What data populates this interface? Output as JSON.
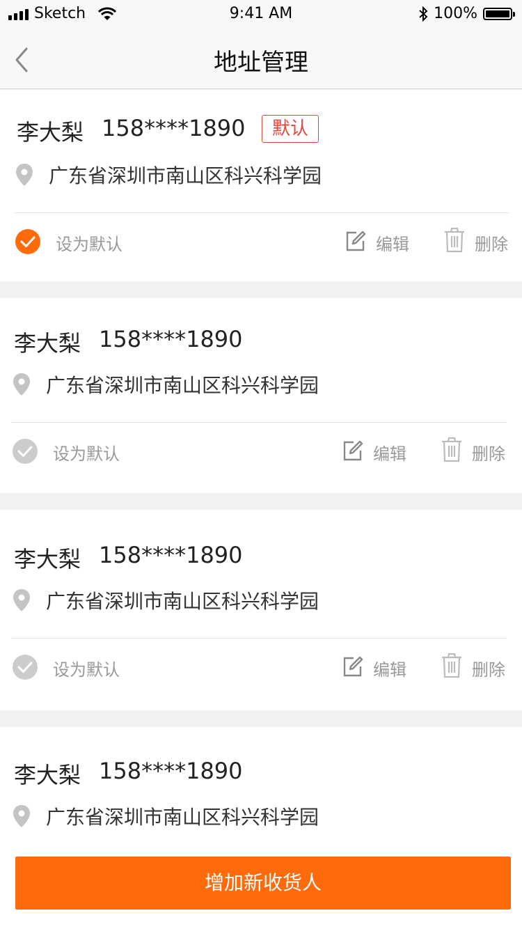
{
  "status_bar": {
    "carrier": "Sketch",
    "time": "9:41 AM",
    "battery": "100%",
    "battery_level": 1.0
  },
  "nav": {
    "title": "地址管理",
    "back_icon": "chevron-left-icon"
  },
  "addresses": [
    {
      "name": "李大梨",
      "phone": "158****1890",
      "tag": "默认",
      "address": "广东省深圳市南山区科兴科学园",
      "is_default": true
    },
    {
      "name": "李大梨",
      "phone": "158****1890",
      "address": "广东省深圳市南山区科兴科学园",
      "is_default": false
    },
    {
      "name": "李大梨",
      "phone": "158****1890",
      "address": "广东省深圳市南山区科兴科学园",
      "is_default": false
    },
    {
      "name": "李大梨",
      "phone": "158****1890",
      "address": "广东省深圳市南山区科兴科学园",
      "is_default": false
    }
  ],
  "actions": {
    "set_default": "设为默认",
    "edit": "编辑",
    "delete": "删除"
  },
  "add_button": "增加新收货人",
  "colors": {
    "accent": "#ff6a0a",
    "default_tag": "#e8463c",
    "inactive_check": "#cccccc",
    "icon_gray": "#888888"
  }
}
